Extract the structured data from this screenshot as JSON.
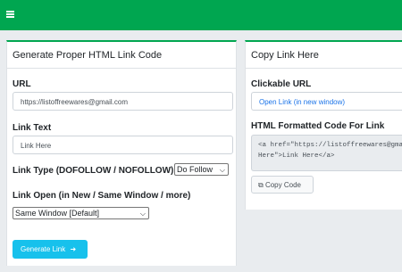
{
  "topbar": {
    "menu_icon": "hamburger-icon",
    "color": "#00a650"
  },
  "left_card": {
    "title": "Generate Proper HTML Link Code",
    "url_label": "URL",
    "url_value": "https://listoffreewares@gmail.com",
    "text_label": "Link Text",
    "text_value": "Link Here",
    "type_label": "Link Type (DOFOLLOW / NOFOLLOW)",
    "type_selected": "Do Follow",
    "open_label": "Link Open (in New / Same Window / more)",
    "open_selected": "Same Window [Default]",
    "generate_button": "Generate Link"
  },
  "right_card": {
    "title": "Copy Link Here",
    "clickable_label": "Clickable URL",
    "clickable_link": "Open Link (in new window)",
    "code_label": "HTML Formatted Code For Link",
    "code_line1": "<a href=\"https://listoffreewares@gmail.co",
    "code_line2": "Here\">Link Here</a>",
    "copy_button": "Copy Code"
  },
  "colors": {
    "accent": "#00a650",
    "button": "#17c1ec",
    "link": "#1a73e8"
  }
}
